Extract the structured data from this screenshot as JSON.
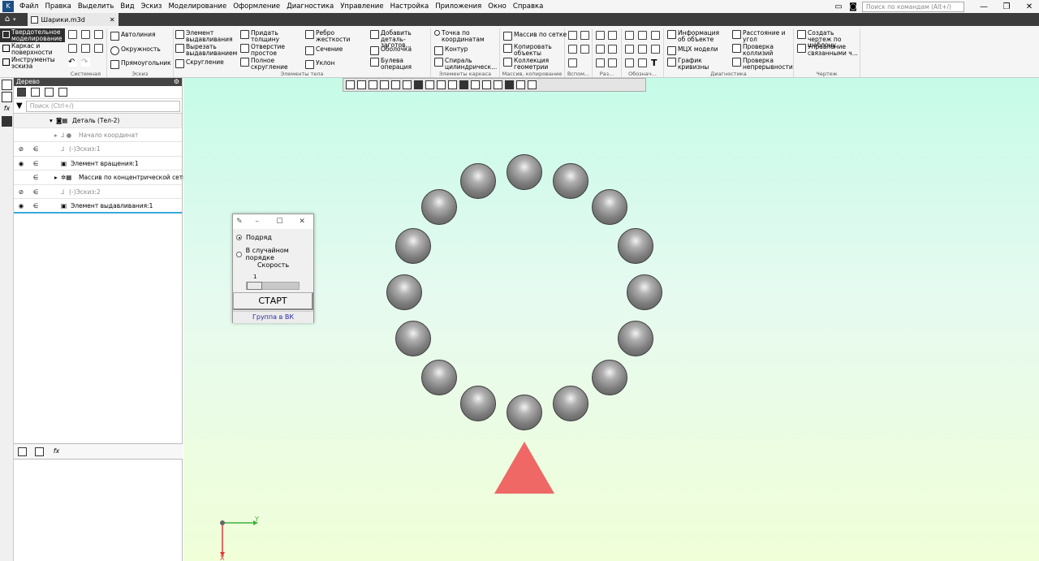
{
  "menubar": {
    "items": [
      "Файл",
      "Правка",
      "Выделить",
      "Вид",
      "Эскиз",
      "Моделирование",
      "Оформление",
      "Диагностика",
      "Управление",
      "Настройка",
      "Приложения",
      "Окно",
      "Справка"
    ],
    "search_placeholder": "Поиск по командам (Alt+/)"
  },
  "tabbar": {
    "tab_title": "Шарики.m3d"
  },
  "ribbon": {
    "modes": [
      "Твердотельное моделирование",
      "Каркас и поверхности",
      "Инструменты эскиза"
    ],
    "groups": {
      "system": "Системная",
      "sketch": "Эскиз",
      "body": "Элементы тела",
      "frame": "Элементы каркаса",
      "array": "Массив, копирование",
      "aux": "Вспом...",
      "size": "Раз...",
      "notation": "Обознач...",
      "diag": "Диагностика",
      "drawing": "Чертеж"
    },
    "sketch": {
      "autoline": "Автолиния",
      "circle": "Окружность",
      "rectangle": "Прямоугольник"
    },
    "body": {
      "extrude": "Элемент выдавливания",
      "cut_extrude": "Вырезать выдавливанием",
      "fillet": "Скругление",
      "thicken": "Придать толщину",
      "simple_hole": "Отверстие простое",
      "full_fillet": "Полное скругление",
      "rib": "Ребро жесткости",
      "section": "Сечение",
      "slope": "Уклон",
      "add_part": "Добавить деталь-заготов...",
      "shell": "Оболочка",
      "boolean": "Булева операция"
    },
    "frame": {
      "point": "Точка по координатам",
      "contour": "Контур",
      "spiral": "Спираль цилиндрическ..."
    },
    "array": {
      "grid": "Массив по сетке",
      "copy": "Копировать объекты",
      "collection": "Коллекция геометрии"
    },
    "diag": {
      "info": "Информация об объекте",
      "mass": "МЦХ модели",
      "graph": "График кривизны",
      "distance": "Расстояние и угол",
      "collisions": "Проверка коллизий",
      "continuity": "Проверка непрерывности"
    },
    "drawing": {
      "create": "Создать чертеж по шаблону",
      "manage": "Управление связанными ч..."
    }
  },
  "tree": {
    "header": "Дерево",
    "search_placeholder": "Поиск (Ctrl+/)",
    "rows": [
      {
        "label": "Деталь (Тел-2)"
      },
      {
        "label": "Начало координат"
      },
      {
        "label": "(-)Эскиз:1"
      },
      {
        "label": "Элемент вращения:1"
      },
      {
        "label": "Массив по концентрической сетке"
      },
      {
        "label": "(-)Эскиз:2"
      },
      {
        "label": "Элемент выдавливания:1"
      }
    ]
  },
  "dialog": {
    "option_sequential": "Подряд",
    "option_random": "В случайном порядке",
    "selected_option": "Подряд",
    "speed_label": "Скорость",
    "speed_value": "1",
    "start_button": "СТАРТ",
    "vk_link": "Группа в ВК"
  },
  "viewport": {
    "ball_count": 16,
    "triangle_color": "#ef6865",
    "axis_y_label": "Y",
    "axis_x_label": "X"
  }
}
